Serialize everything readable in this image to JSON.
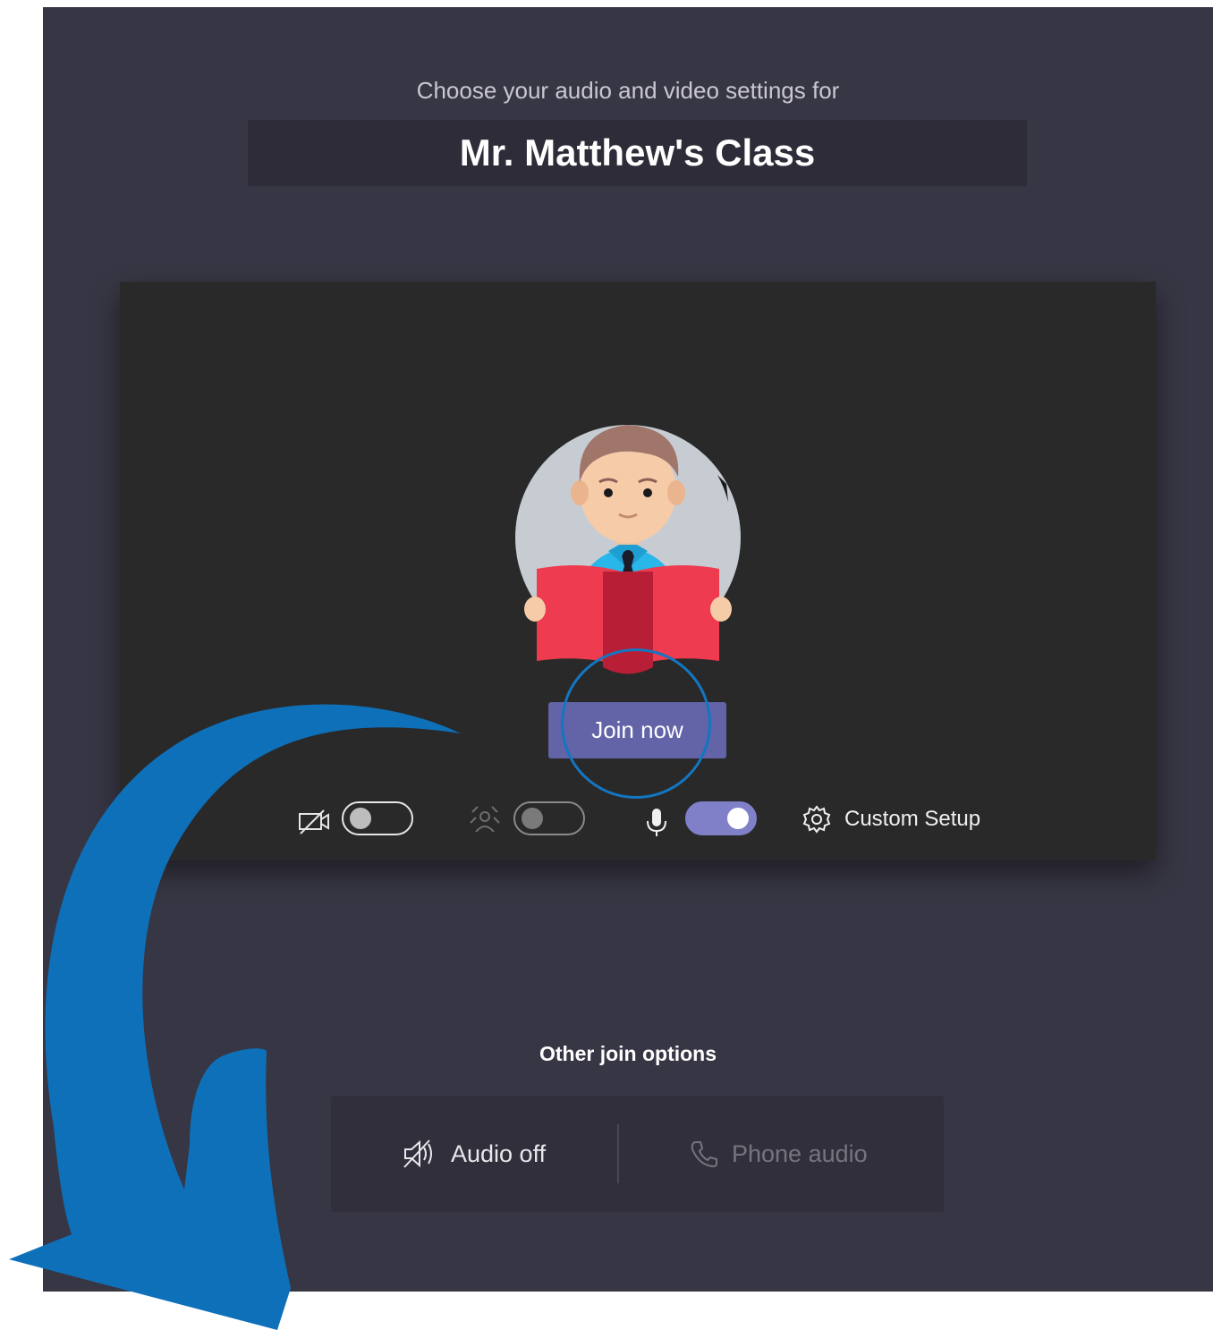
{
  "header": {
    "subtitle": "Choose your audio and video settings for",
    "meeting_title": "Mr. Matthew's Class"
  },
  "preview": {
    "join_button_label": "Join now",
    "controls": {
      "camera_toggle": "off",
      "background_blur_toggle": "off",
      "microphone_toggle": "on",
      "custom_setup_label": "Custom Setup"
    }
  },
  "other_options": {
    "title": "Other join options",
    "audio_off_label": "Audio off",
    "phone_audio_label": "Phone audio"
  },
  "colors": {
    "panel_background": "#373644",
    "join_button": "#6264a7",
    "toggle_on": "#7f80c8",
    "annotation_blue": "#1376c2"
  }
}
